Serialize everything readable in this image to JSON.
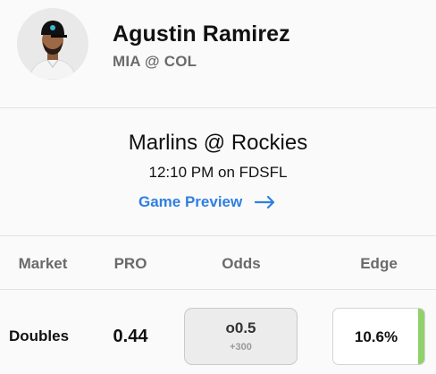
{
  "player": {
    "name": "Agustin Ramirez",
    "matchup": "MIA @ COL",
    "avatar_icon": "player-headshot"
  },
  "game": {
    "title": "Marlins @ Rockies",
    "time": "12:10 PM on FDSFL",
    "preview_label": "Game Preview",
    "preview_icon": "arrow-right-icon",
    "accent_color": "#2f7fe0"
  },
  "table": {
    "headers": {
      "market": "Market",
      "pro": "PRO",
      "odds": "Odds",
      "edge": "Edge"
    },
    "rows": [
      {
        "market": "Doubles",
        "pro": "0.44",
        "odds_line": "o0.5",
        "odds_price": "+300",
        "edge": "10.6%",
        "edge_color": "#8fd16a"
      }
    ]
  }
}
